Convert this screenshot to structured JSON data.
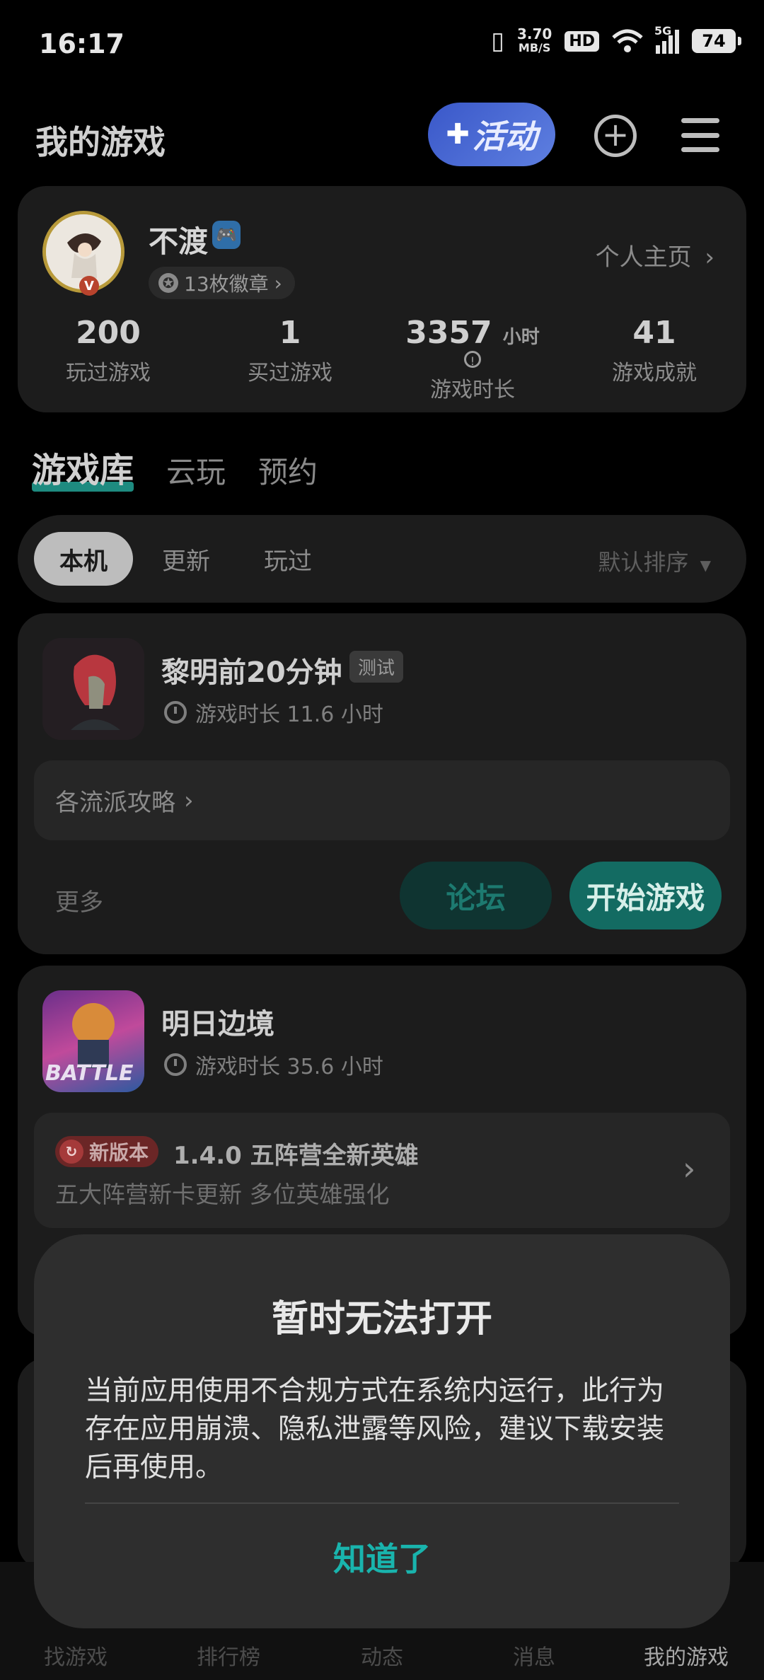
{
  "status_bar": {
    "time": "16:17",
    "net_speed_top": "3.70",
    "net_speed_unit": "MB/S",
    "hd": "HD",
    "signal": "5G",
    "battery": "74"
  },
  "header": {
    "title": "我的游戏",
    "event_label": "活动",
    "add_symbol": "+"
  },
  "profile": {
    "username": "不渡",
    "vip_letter": "V",
    "medals": "13枚徽章",
    "profile_link": "个人主页",
    "stats": [
      {
        "value": "200",
        "unit": "",
        "label": "玩过游戏"
      },
      {
        "value": "1",
        "unit": "",
        "label": "买过游戏"
      },
      {
        "value": "3357",
        "unit": "小时",
        "label": "游戏时长"
      },
      {
        "value": "41",
        "unit": "",
        "label": "游戏成就"
      }
    ]
  },
  "tabs": [
    "游戏库",
    "云玩",
    "预约"
  ],
  "filters": {
    "chips": [
      "本机",
      "更新",
      "玩过"
    ],
    "sort": "默认排序"
  },
  "games": [
    {
      "name": "黎明前20分钟",
      "tag": "测试",
      "playtime": "游戏时长 11.6 小时",
      "guide": "各流派攻略",
      "more": "更多",
      "forum": "论坛",
      "start": "开始游戏"
    },
    {
      "name": "明日边境",
      "playtime": "游戏时长 35.6 小时",
      "update_tag": "新版本",
      "update_title": "1.4.0 五阵营全新英雄",
      "update_sub": "五大阵营新卡更新 多位英雄强化",
      "icon_text": "BATTLE"
    }
  ],
  "bottom_nav": [
    "找游戏",
    "排行榜",
    "动态",
    "消息",
    "我的游戏"
  ],
  "dialog": {
    "title": "暂时无法打开",
    "body": "当前应用使用不合规方式在系统内运行，此行为存在应用崩溃、隐私泄露等风险，建议下载安装后再使用。",
    "button": "知道了"
  },
  "colors": {
    "accent": "#19b4ad",
    "start_button": "#136b62",
    "forum_button": "#0f3431"
  }
}
